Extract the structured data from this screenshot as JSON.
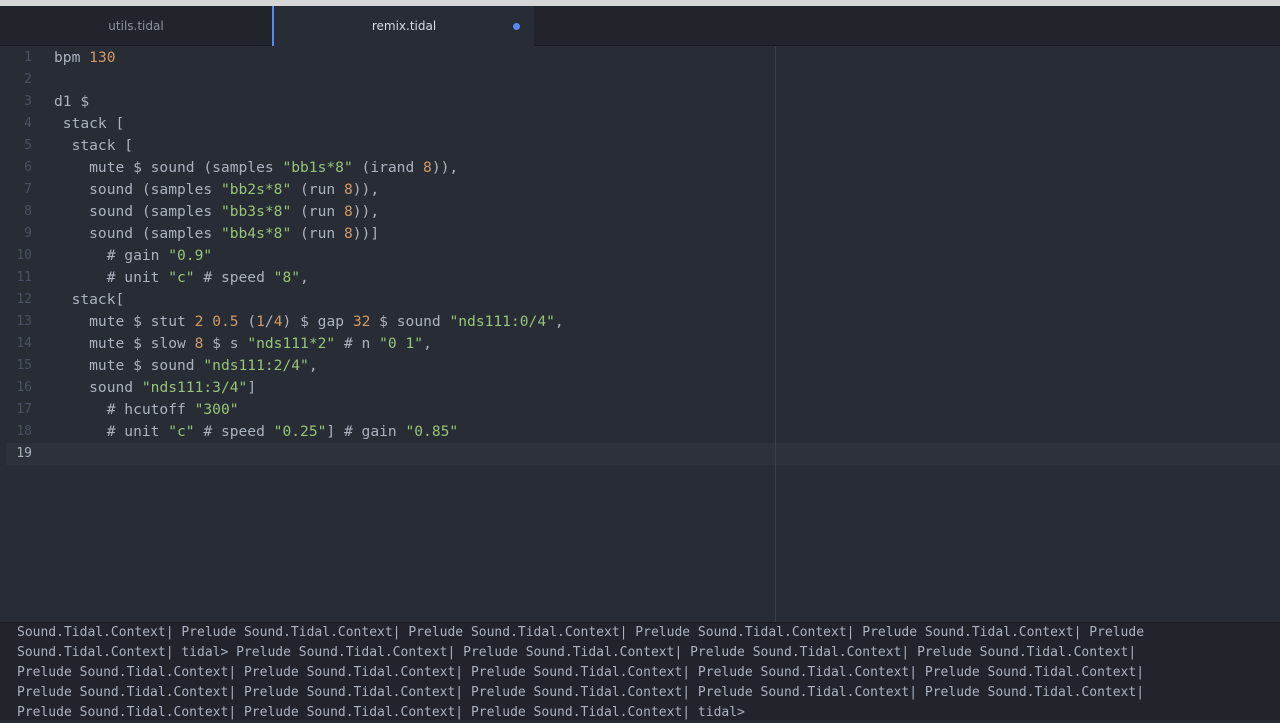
{
  "tabs": [
    {
      "label": "utils.tidal",
      "active": false
    },
    {
      "label": "remix.tidal",
      "active": true,
      "modified": true
    }
  ],
  "editor": {
    "current_line": 19,
    "lines": [
      {
        "num": "1",
        "tokens": [
          [
            "t",
            "bpm "
          ],
          [
            "n",
            "130"
          ]
        ]
      },
      {
        "num": "2",
        "tokens": []
      },
      {
        "num": "3",
        "tokens": [
          [
            "t",
            "d1 $"
          ]
        ]
      },
      {
        "num": "4",
        "tokens": [
          [
            "t",
            " stack ["
          ]
        ]
      },
      {
        "num": "5",
        "tokens": [
          [
            "t",
            "  stack ["
          ]
        ]
      },
      {
        "num": "6",
        "tokens": [
          [
            "t",
            "    mute $ sound (samples "
          ],
          [
            "s",
            "\"bb1s*8\""
          ],
          [
            "t",
            " (irand "
          ],
          [
            "n",
            "8"
          ],
          [
            "t",
            ")),"
          ]
        ]
      },
      {
        "num": "7",
        "tokens": [
          [
            "t",
            "    sound (samples "
          ],
          [
            "s",
            "\"bb2s*8\""
          ],
          [
            "t",
            " (run "
          ],
          [
            "n",
            "8"
          ],
          [
            "t",
            ")),"
          ]
        ]
      },
      {
        "num": "8",
        "tokens": [
          [
            "t",
            "    sound (samples "
          ],
          [
            "s",
            "\"bb3s*8\""
          ],
          [
            "t",
            " (run "
          ],
          [
            "n",
            "8"
          ],
          [
            "t",
            ")),"
          ]
        ]
      },
      {
        "num": "9",
        "tokens": [
          [
            "t",
            "    sound (samples "
          ],
          [
            "s",
            "\"bb4s*8\""
          ],
          [
            "t",
            " (run "
          ],
          [
            "n",
            "8"
          ],
          [
            "t",
            "))]"
          ]
        ]
      },
      {
        "num": "10",
        "tokens": [
          [
            "t",
            "      # gain "
          ],
          [
            "s",
            "\"0.9\""
          ]
        ]
      },
      {
        "num": "11",
        "tokens": [
          [
            "t",
            "      # unit "
          ],
          [
            "s",
            "\"c\""
          ],
          [
            "t",
            " # speed "
          ],
          [
            "s",
            "\"8\""
          ],
          [
            "t",
            ","
          ]
        ]
      },
      {
        "num": "12",
        "tokens": [
          [
            "t",
            "  stack["
          ]
        ]
      },
      {
        "num": "13",
        "tokens": [
          [
            "t",
            "    mute $ stut "
          ],
          [
            "n",
            "2"
          ],
          [
            "t",
            " "
          ],
          [
            "n",
            "0.5"
          ],
          [
            "t",
            " ("
          ],
          [
            "n",
            "1"
          ],
          [
            "t",
            "/"
          ],
          [
            "n",
            "4"
          ],
          [
            "t",
            ") $ gap "
          ],
          [
            "n",
            "32"
          ],
          [
            "t",
            " $ sound "
          ],
          [
            "s",
            "\"nds111:0/4\""
          ],
          [
            "t",
            ","
          ]
        ]
      },
      {
        "num": "14",
        "tokens": [
          [
            "t",
            "    mute $ slow "
          ],
          [
            "n",
            "8"
          ],
          [
            "t",
            " $ s "
          ],
          [
            "s",
            "\"nds111*2\""
          ],
          [
            "t",
            " # n "
          ],
          [
            "s",
            "\"0 1\""
          ],
          [
            "t",
            ","
          ]
        ]
      },
      {
        "num": "15",
        "tokens": [
          [
            "t",
            "    mute $ sound "
          ],
          [
            "s",
            "\"nds111:2/4\""
          ],
          [
            "t",
            ","
          ]
        ]
      },
      {
        "num": "16",
        "tokens": [
          [
            "t",
            "    sound "
          ],
          [
            "s",
            "\"nds111:3/4\""
          ],
          [
            "t",
            "]"
          ]
        ]
      },
      {
        "num": "17",
        "tokens": [
          [
            "t",
            "      # hcutoff "
          ],
          [
            "s",
            "\"300\""
          ]
        ]
      },
      {
        "num": "18",
        "tokens": [
          [
            "t",
            "      # unit "
          ],
          [
            "s",
            "\"c\""
          ],
          [
            "t",
            " # speed "
          ],
          [
            "s",
            "\"0.25\""
          ],
          [
            "t",
            "] # gain "
          ],
          [
            "s",
            "\"0.85\""
          ]
        ]
      },
      {
        "num": "19",
        "tokens": []
      }
    ]
  },
  "console": {
    "lines": [
      "Sound.Tidal.Context| Prelude Sound.Tidal.Context| Prelude Sound.Tidal.Context| Prelude Sound.Tidal.Context| Prelude Sound.Tidal.Context| Prelude",
      "Sound.Tidal.Context| tidal> Prelude Sound.Tidal.Context| Prelude Sound.Tidal.Context| Prelude Sound.Tidal.Context| Prelude Sound.Tidal.Context|",
      "Prelude Sound.Tidal.Context| Prelude Sound.Tidal.Context| Prelude Sound.Tidal.Context| Prelude Sound.Tidal.Context| Prelude Sound.Tidal.Context|",
      "Prelude Sound.Tidal.Context| Prelude Sound.Tidal.Context| Prelude Sound.Tidal.Context| Prelude Sound.Tidal.Context| Prelude Sound.Tidal.Context|",
      "Prelude Sound.Tidal.Context| Prelude Sound.Tidal.Context| Prelude Sound.Tidal.Context| tidal>"
    ]
  },
  "colors": {
    "background": "#282c34",
    "string": "#98c379",
    "number": "#d19a66",
    "accent": "#568af2"
  }
}
